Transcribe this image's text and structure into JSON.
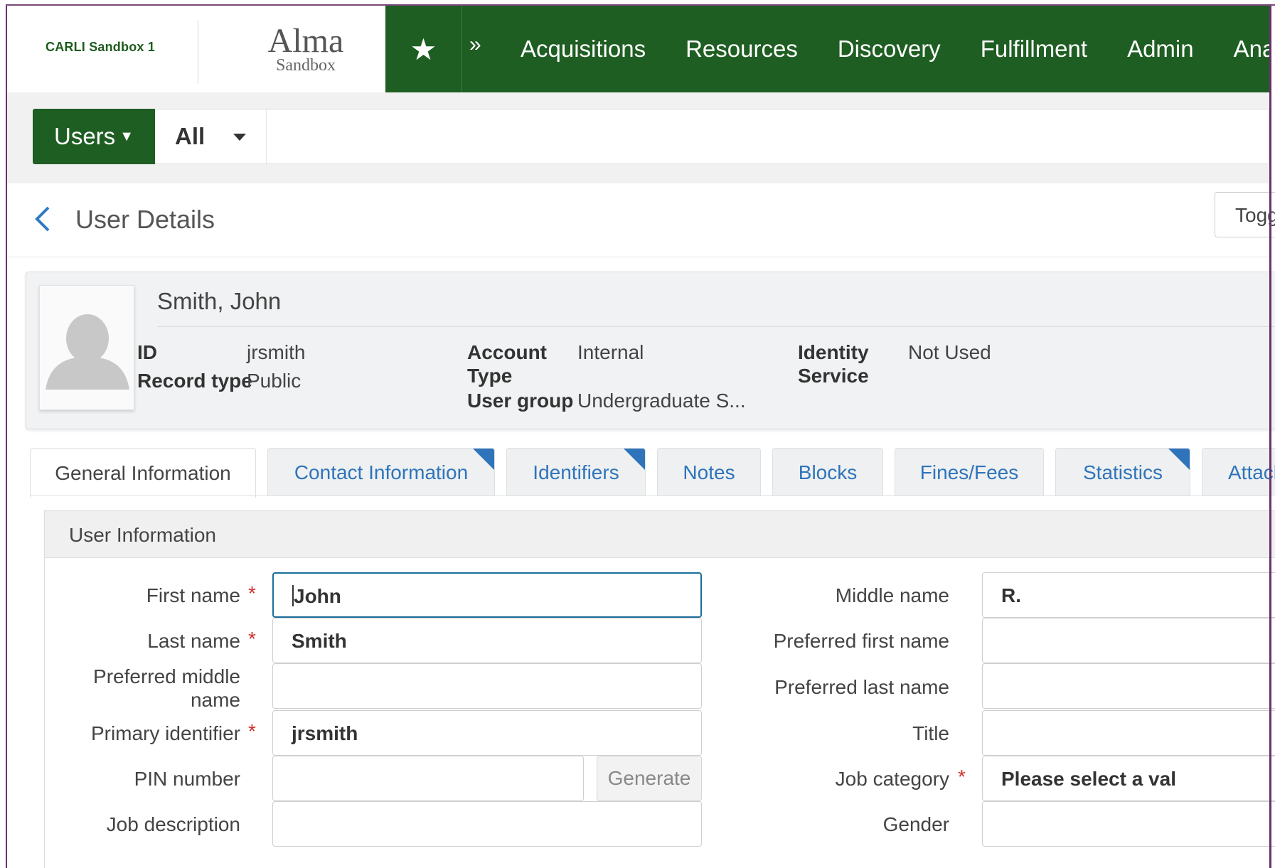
{
  "header": {
    "institution": "CARLI Sandbox 1",
    "logo_main": "Alma",
    "logo_sub": "Sandbox",
    "favorites_icon": "star-icon",
    "more_icon": "double-chevron-right-icon",
    "nav": [
      "Acquisitions",
      "Resources",
      "Discovery",
      "Fulfillment",
      "Admin",
      "Analy"
    ]
  },
  "search": {
    "scope_label": "Users",
    "filter_value": "All",
    "query": ""
  },
  "page": {
    "title": "User Details",
    "back_icon": "chevron-left-icon",
    "toggle_label": "Togg"
  },
  "user_card": {
    "name": "Smith, John",
    "fields": {
      "id_label": "ID",
      "id_value": "jrsmith",
      "record_type_label": "Record type",
      "record_type_value": "Public",
      "account_type_label_1": "Account",
      "account_type_label_2": "Type",
      "account_type_value": "Internal",
      "user_group_label": "User group",
      "user_group_value": "Undergraduate S...",
      "identity_service_label_1": "Identity",
      "identity_service_label_2": "Service",
      "identity_service_value": "Not Used"
    }
  },
  "tabs": [
    {
      "label": "General Information",
      "active": true
    },
    {
      "label": "Contact Information",
      "flag": true
    },
    {
      "label": "Identifiers",
      "flag": true
    },
    {
      "label": "Notes"
    },
    {
      "label": "Blocks"
    },
    {
      "label": "Fines/Fees"
    },
    {
      "label": "Statistics",
      "flag": true
    },
    {
      "label": "Attach"
    }
  ],
  "form": {
    "section_title": "User Information",
    "required_mark": "*",
    "first_name_label": "First name",
    "first_name_value": "John",
    "last_name_label": "Last name",
    "last_name_value": "Smith",
    "preferred_middle_label_1": "Preferred middle",
    "preferred_middle_label_2": "name",
    "preferred_middle_value": "",
    "primary_identifier_label": "Primary identifier",
    "primary_identifier_value": "jrsmith",
    "pin_label": "PIN number",
    "pin_value": "",
    "generate_label": "Generate",
    "job_description_label": "Job description",
    "job_description_value": "",
    "middle_name_label": "Middle name",
    "middle_name_value": "R.",
    "preferred_first_label": "Preferred first name",
    "preferred_first_value": "",
    "preferred_last_label": "Preferred last name",
    "preferred_last_value": "",
    "title_label": "Title",
    "title_value": "",
    "job_category_label": "Job category",
    "job_category_value": "Please select a val",
    "gender_label": "Gender",
    "gender_value": ""
  },
  "colors": {
    "nav_green": "#1f5e23",
    "link_blue": "#2f74bb",
    "required_red": "#d0312d",
    "focus_border": "#1b6e9a"
  }
}
